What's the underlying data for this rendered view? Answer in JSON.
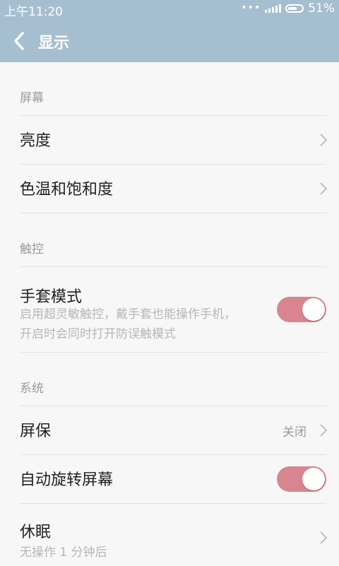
{
  "status_bar": {
    "time": "上午11:20",
    "battery": "51%"
  },
  "header": {
    "title": "显示"
  },
  "sections": [
    {
      "label": "屏幕"
    },
    {
      "label": "触控"
    },
    {
      "label": "系统"
    }
  ],
  "items": {
    "brightness": {
      "label": "亮度"
    },
    "color_temp": {
      "label": "色温和饱和度"
    },
    "glove_mode": {
      "label": "手套模式",
      "desc": "启用超灵敏触控，戴手套也能操作手机，开启时会同时打开防误触模式",
      "enabled": true
    },
    "screensaver": {
      "label": "屏保",
      "value": "关闭"
    },
    "auto_rotate": {
      "label": "自动旋转屏幕",
      "enabled": true
    },
    "sleep": {
      "label": "休眠",
      "desc": "无操作 1 分钟后"
    }
  },
  "colors": {
    "header_bg": "#a6bfd0",
    "toggle_on": "#d9858f",
    "page_bg": "#f7f7f7"
  }
}
